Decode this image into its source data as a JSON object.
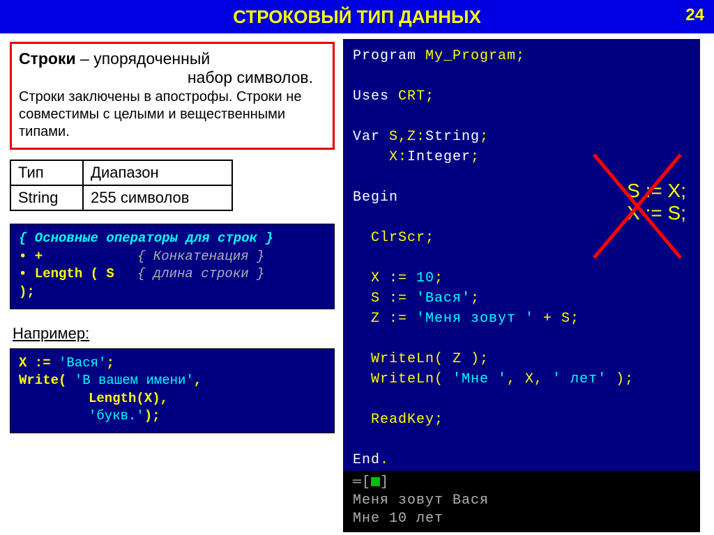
{
  "header": {
    "title": "СТРОКОВЫЙ ТИП ДАННЫХ",
    "page": "24"
  },
  "definition": {
    "line1_bold": "Строки",
    "line1_rest": " – упорядоченный",
    "line2": "набор символов.",
    "sub": "Строки заключены в апострофы. Строки не совместимы с целыми и вещественными типами."
  },
  "type_table": {
    "h1": "Тип",
    "h2": "Диапазон",
    "r1": "String",
    "r2": "255 символов"
  },
  "ops": {
    "title": "{ Основные операторы для строк }",
    "row1_op": "• +",
    "row1_cm": "{ Конкатенация }",
    "row2_op": "• Length ( S );",
    "row2_cm": "{ длина строки }"
  },
  "naprimer": "Например:",
  "example": {
    "l1_a": "X := ",
    "l1_b": "'Вася'",
    "l1_c": ";",
    "l2_a": "Write( ",
    "l2_b": "'В вашем имени'",
    "l2_c": ",",
    "l3": "Length(X),",
    "l4_a": "'букв.'",
    "l4_b": ");"
  },
  "code": {
    "l1_kw": "Program ",
    "l1_id": "My_Program",
    "l1_end": ";",
    "l2_kw": "Uses ",
    "l2_id": "CRT",
    "l2_end": ";",
    "l3_kw": "Var ",
    "l3_a": "S,Z:",
    "l3_b": "String",
    "l3_c": ";",
    "l4_a": "X:",
    "l4_b": "Integer",
    "l4_c": ";",
    "l5": "Begin",
    "l6": "ClrScr;",
    "l7_a": "X := ",
    "l7_b": "10",
    "l7_c": ";",
    "l8_a": "S := ",
    "l8_b": "'Вася'",
    "l8_c": ";",
    "l9_a": "Z := ",
    "l9_b": "'Меня зовут '",
    "l9_c": " + S;",
    "l10_a": "WriteLn( Z );",
    "l11_a": "WriteLn( ",
    "l11_b": "'Мне '",
    "l11_c": ", X, ",
    "l11_d": "' лет'",
    "l11_e": " );",
    "l12": "ReadKey;",
    "l13_a": "End",
    "l13_b": "."
  },
  "wrong": {
    "l1": "S := X;",
    "l2": "X := S;"
  },
  "output": {
    "prompt_open": "═[",
    "prompt_close": "]",
    "l1": "Меня зовут Вася",
    "l2": "Мне 10 лет"
  }
}
